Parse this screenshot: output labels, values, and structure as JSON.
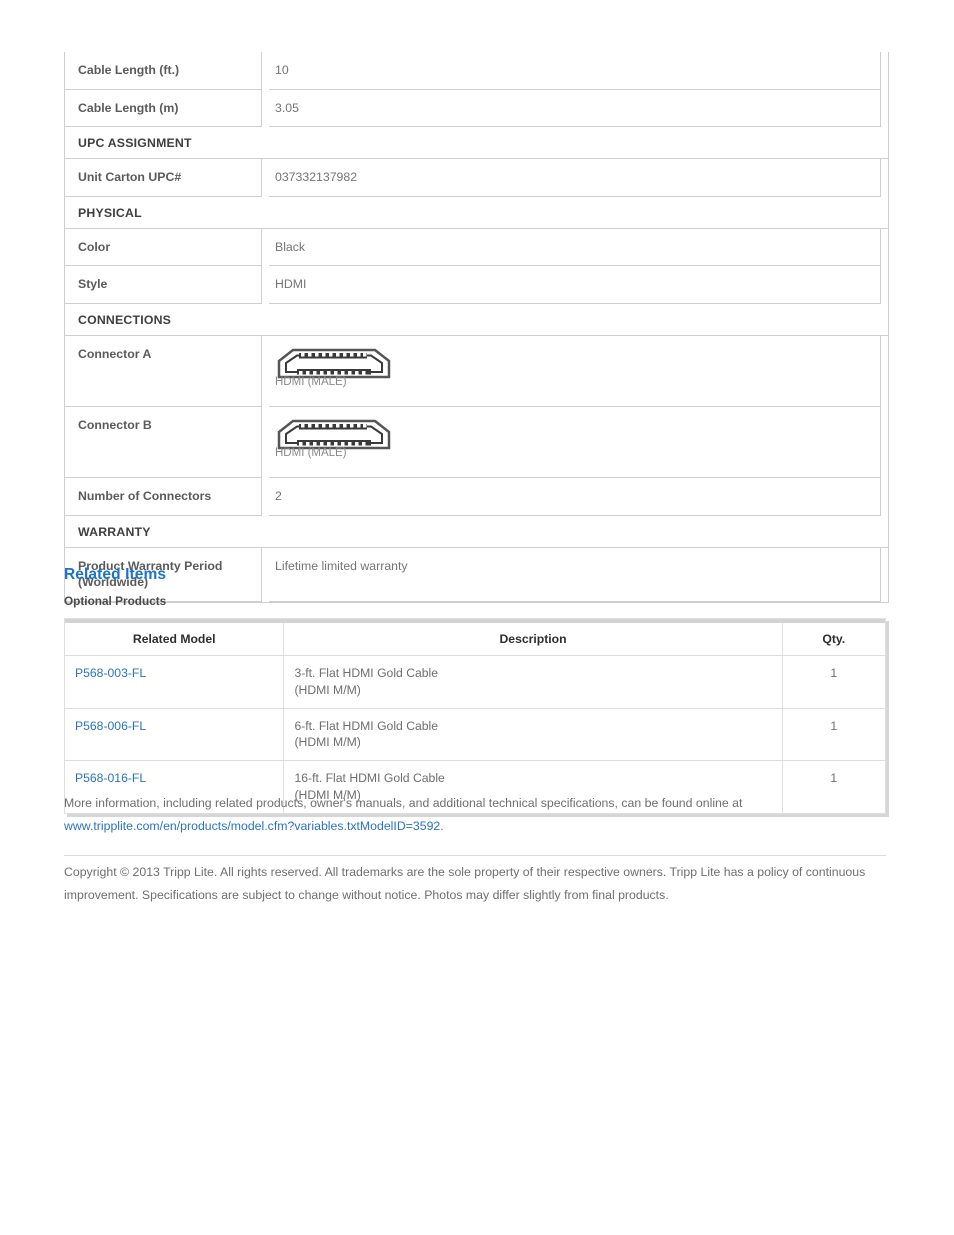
{
  "spec_table": {
    "rows": [
      {
        "kind": "row",
        "label": "Cable Length (ft.)",
        "value": "10"
      },
      {
        "kind": "row",
        "label": "Cable Length (m)",
        "value": "3.05"
      },
      {
        "kind": "section",
        "label": "UPC ASSIGNMENT"
      },
      {
        "kind": "row",
        "label": "Unit Carton UPC#",
        "value": "037332137982"
      },
      {
        "kind": "section",
        "label": "PHYSICAL"
      },
      {
        "kind": "row",
        "label": "Color",
        "value": "Black"
      },
      {
        "kind": "row",
        "label": "Style",
        "value": "HDMI"
      },
      {
        "kind": "section",
        "label": "CONNECTIONS"
      },
      {
        "kind": "connector",
        "label": "Connector A",
        "value": "HDMI (MALE)",
        "icon": "hdmi-connector-icon"
      },
      {
        "kind": "connector",
        "label": "Connector B",
        "value": "HDMI (MALE)",
        "icon": "hdmi-connector-icon"
      },
      {
        "kind": "row",
        "label": "Number of Connectors",
        "value": "2"
      },
      {
        "kind": "section",
        "label": "WARRANTY"
      },
      {
        "kind": "row",
        "label": "Product Warranty Period (Worldwide)",
        "value": "Lifetime limited warranty"
      }
    ]
  },
  "related": {
    "heading": "Related Items",
    "subheading": "Optional Products",
    "columns": [
      "Related Model",
      "Description",
      "Qty."
    ],
    "rows": [
      {
        "model": "P568-003-FL",
        "description": "3-ft. Flat HDMI Gold Cable\n(HDMI M/M)",
        "qty": "1"
      },
      {
        "model": "P568-006-FL",
        "description": "6-ft. Flat HDMI Gold Cable\n(HDMI M/M)",
        "qty": "1"
      },
      {
        "model": "P568-016-FL",
        "description": "16-ft. Flat HDMI Gold Cable\n(HDMI M/M)",
        "qty": "1"
      }
    ]
  },
  "footer": {
    "more_info_text": "More information, including related products, owner's manuals, and additional technical specifications, can be found online at ",
    "more_info_url": "www.tripplite.com/en/products/model.cfm?variables.txtModelID=3592",
    "more_info_period": ".",
    "copyright": "Copyright © 2013 Tripp Lite. All rights reserved. All trademarks are the sole property of their respective owners. Tripp Lite has a policy of continuous improvement. Specifications are subject to change without notice. Photos may differ slightly from final products."
  },
  "colors": {
    "link": "#2a72c4",
    "heading": "#1a73c8",
    "border": "#cfcfcf",
    "text": "#6e6e6e"
  }
}
